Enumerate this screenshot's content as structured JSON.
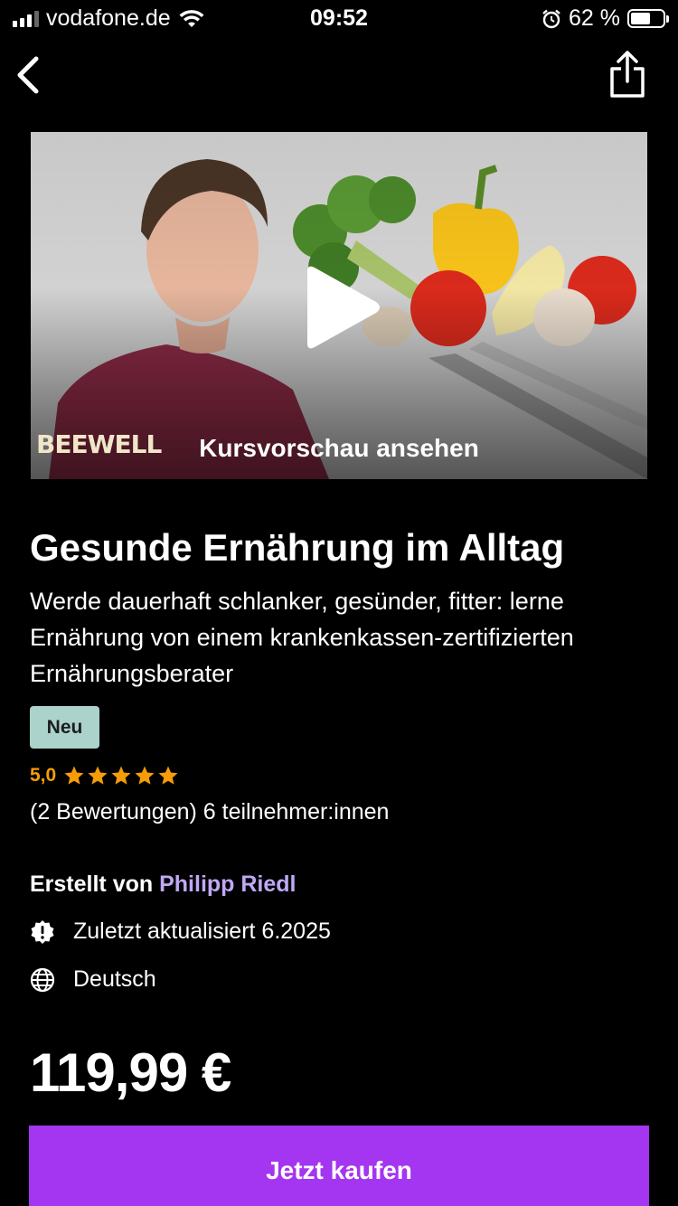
{
  "status_bar": {
    "carrier": "vodafone.de",
    "time": "09:52",
    "battery_percent": "62 %",
    "battery_level": 0.62
  },
  "nav": {
    "back_icon": "chevron-left-icon",
    "share_icon": "share-icon"
  },
  "preview": {
    "label": "Kursvorschau ansehen",
    "brand": "BEEWELL"
  },
  "course": {
    "title": "Gesunde Ernährung im Alltag",
    "subtitle": "Werde dauerhaft schlanker, gesünder, fitter: lerne Ernährung von einem krankenkassen-zertifizierten Ernährungsberater",
    "badge": "Neu",
    "rating": "5,0",
    "rating_stars": 5,
    "reviews_and_students": "(2 Bewertungen) 6 teilnehmer:innen",
    "created_by_label": "Erstellt von",
    "instructor": "Philipp Riedl",
    "last_updated": "Zuletzt aktualisiert 6.2025",
    "language": "Deutsch",
    "price": "119,99 €"
  },
  "actions": {
    "buy_label": "Jetzt kaufen"
  },
  "colors": {
    "accent": "#a435f0",
    "star": "#f69c08",
    "badge_bg": "#acd2cc",
    "link": "#c0a8f5"
  }
}
